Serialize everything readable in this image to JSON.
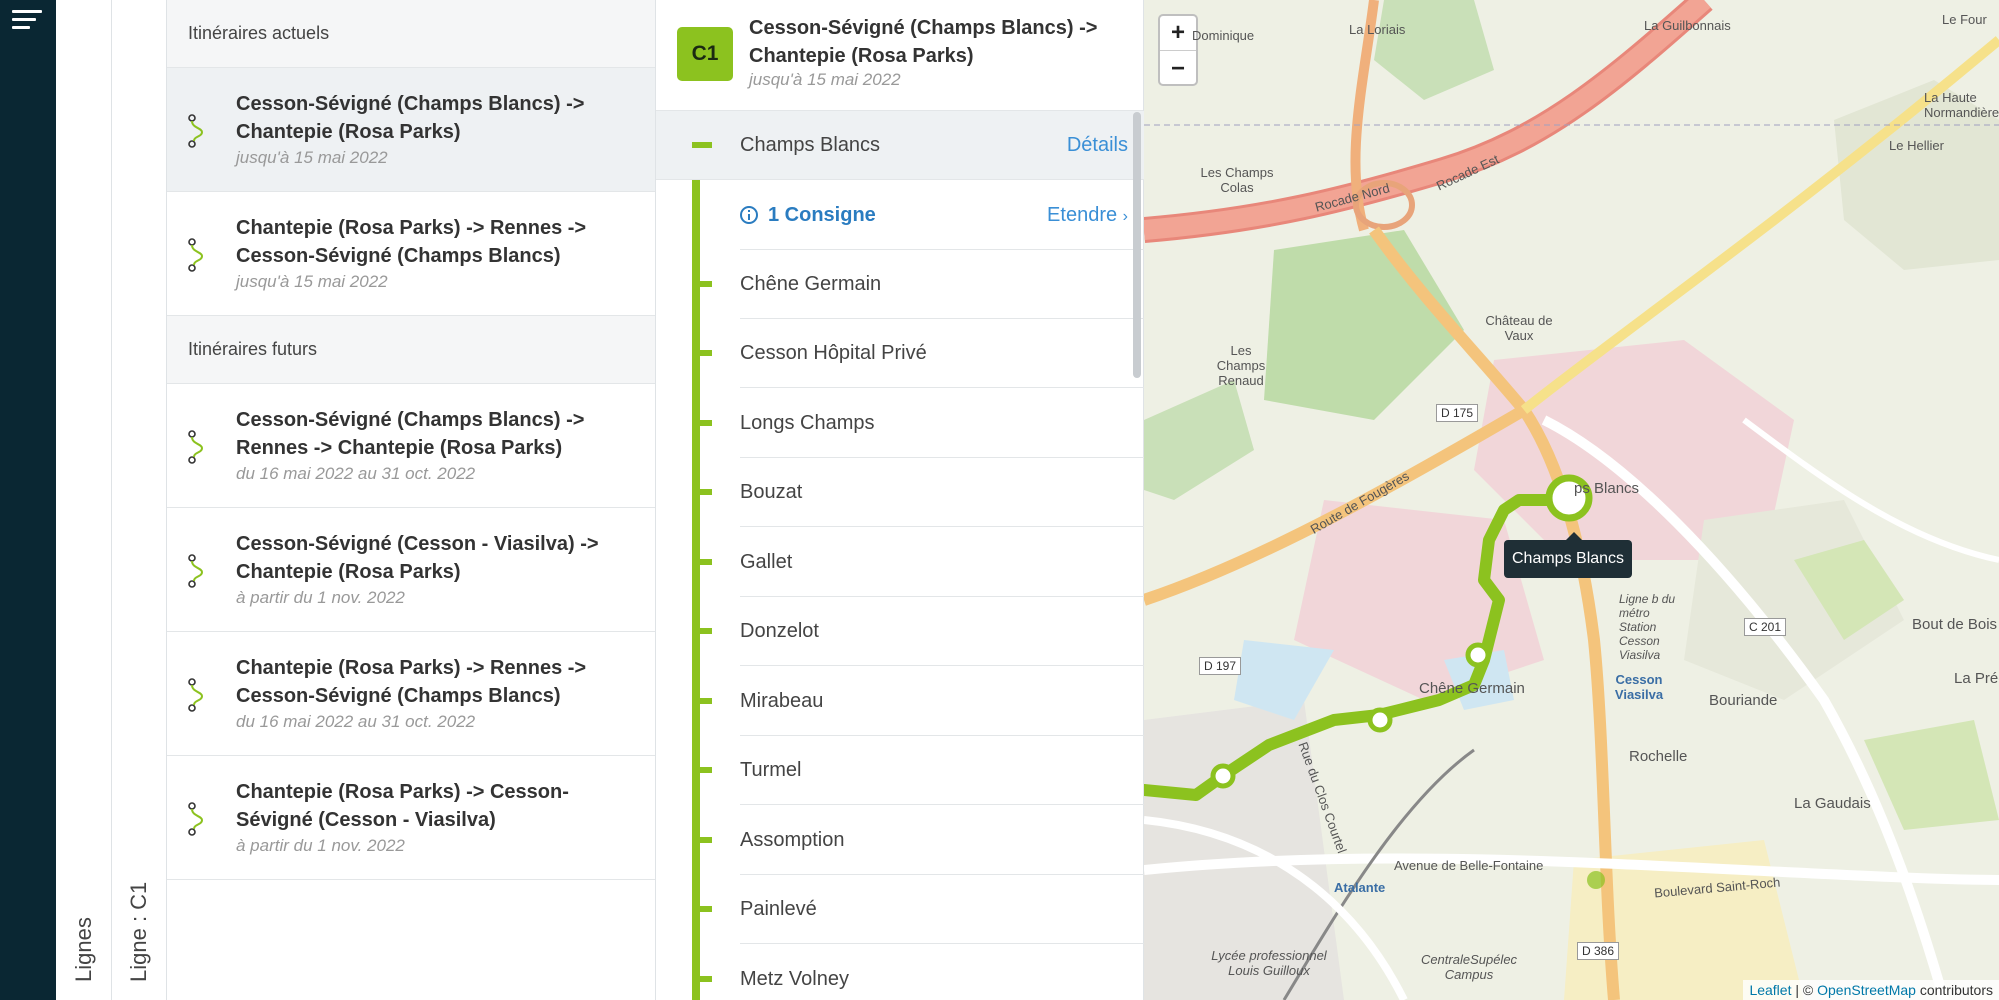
{
  "panels": {
    "lines_label": "Lignes",
    "line_label": "Ligne : C1"
  },
  "itineraries": {
    "current_header": "Itinéraires actuels",
    "current": [
      {
        "title": "Cesson-Sévigné (Champs Blancs) -> Chantepie (Rosa Parks)",
        "dates": "jusqu'à 15 mai 2022"
      },
      {
        "title": "Chantepie (Rosa Parks) -> Rennes -> Cesson-Sévigné (Champs Blancs)",
        "dates": "jusqu'à 15 mai 2022"
      }
    ],
    "future_header": "Itinéraires futurs",
    "future": [
      {
        "title": "Cesson-Sévigné (Champs Blancs) -> Rennes -> Chantepie (Rosa Parks)",
        "dates": "du 16 mai 2022 au 31 oct. 2022"
      },
      {
        "title": "Cesson-Sévigné (Cesson - Viasilva) -> Chantepie (Rosa Parks)",
        "dates": "à partir du 1 nov. 2022"
      },
      {
        "title": "Chantepie (Rosa Parks) -> Rennes -> Cesson-Sévigné (Champs Blancs)",
        "dates": "du 16 mai 2022 au 31 oct. 2022"
      },
      {
        "title": "Chantepie (Rosa Parks) -> Cesson-Sévigné (Cesson - Viasilva)",
        "dates": "à partir du 1 nov. 2022"
      }
    ]
  },
  "route": {
    "badge": "C1",
    "badge_color": "#8cc21f",
    "title": "Cesson-Sévigné (Champs Blancs) -> Chantepie (Rosa Parks)",
    "dates": "jusqu'à 15 mai 2022",
    "first_stop": "Champs Blancs",
    "details_link": "Détails",
    "consigne": "1 Consigne",
    "expand_link": "Etendre",
    "stops": [
      "Chêne Germain",
      "Cesson Hôpital Privé",
      "Longs Champs",
      "Bouzat",
      "Gallet",
      "Donzelot",
      "Mirabeau",
      "Turmel",
      "Assomption",
      "Painlevé",
      "Metz Volney"
    ]
  },
  "map": {
    "zoom_in": "+",
    "zoom_out": "−",
    "tooltip": "Champs Blancs",
    "attribution": {
      "leaflet": "Leaflet",
      "sep": " | © ",
      "osm": "OpenStreetMap",
      "suffix": " contributors"
    },
    "labels": {
      "dominique": "Dominique",
      "loriais": "La Loriais",
      "guilbonnais": "La Guilbonnais",
      "four": "Le Four",
      "haute_normandiere": "La Haute Normandière",
      "hellier": "Le Hellier",
      "champs_colas": "Les Champs Colas",
      "chateau_vaux": "Château de Vaux",
      "champs_renaud": "Les Champs Renaud",
      "champs_blancs": "ps Blancs",
      "chene_germain": "Chêne Germain",
      "cesson_viasilva": "Cesson Viasilva",
      "bouriande": "Bouriande",
      "bout_de_bois": "Bout de Bois",
      "la_pree": "La Prée",
      "rochelle": "Rochelle",
      "la_gaudais": "La Gaudais",
      "atalante": "Atalante",
      "lycee": "Lycée professionnel Louis Guilloux",
      "centralesupelec": "CentraleSupélec Campus",
      "rocade_nord": "Rocade Nord",
      "rocade_est": "Rocade Est",
      "route_fougeres": "Route de Fougères",
      "boulevard_st_roch": "Boulevard Saint-Roch",
      "avenue_belle_fontaine": "Avenue de Belle-Fontaine",
      "rue_clos_courtel": "Rue du Clos Courtel",
      "metro": "Ligne b du métro Station Cesson Viasilva"
    },
    "roads": {
      "d175": "D 175",
      "d197": "D 197",
      "c201": "C 201",
      "d386": "D 386"
    }
  }
}
